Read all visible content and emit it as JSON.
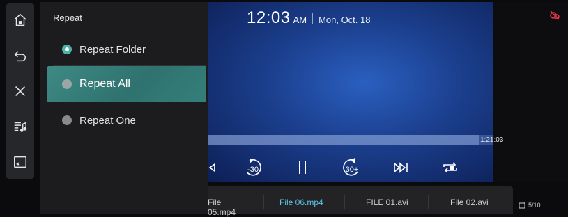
{
  "panel": {
    "title": "Repeat",
    "options": [
      {
        "label": "Repeat Folder",
        "checked": true,
        "highlighted": false
      },
      {
        "label": "Repeat All",
        "checked": false,
        "highlighted": true
      },
      {
        "label": "Repeat One",
        "checked": false,
        "highlighted": false
      }
    ]
  },
  "clock": {
    "time": "12:03",
    "ampm": "AM",
    "date": "Mon, Oct. 18"
  },
  "player": {
    "elapsed": "1:21:03",
    "progress_fraction": 0.95,
    "controls": [
      "prev",
      "rewind-30",
      "pause",
      "forward-30",
      "next",
      "repeat"
    ],
    "rewind_label": "-30",
    "forward_label": "30+"
  },
  "files": [
    {
      "name": "File 05.mp4",
      "active": false
    },
    {
      "name": "File 06.mp4",
      "active": true
    },
    {
      "name": "FILE 01.avi",
      "active": false
    },
    {
      "name": "File 02.avi",
      "active": false
    }
  ],
  "page_count": "5/10",
  "colors": {
    "accent": "#4db3a6",
    "active_file": "#5cc5e6",
    "video": "#1b3e8c"
  },
  "rail_icons": [
    "home-icon",
    "back-icon",
    "close-icon",
    "playlist-icon",
    "screen-icon"
  ]
}
